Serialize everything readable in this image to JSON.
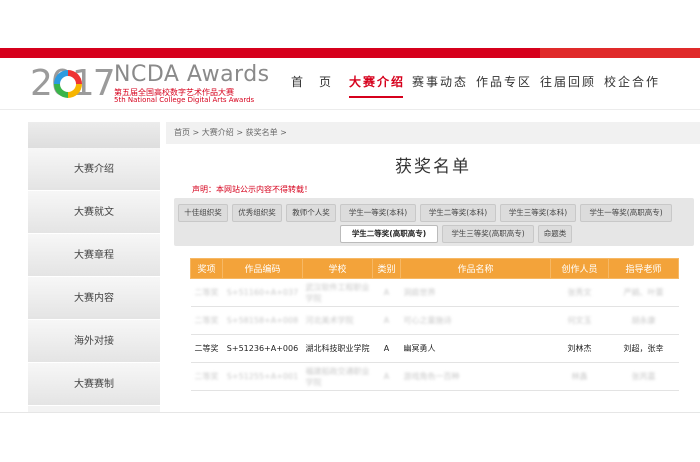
{
  "header": {
    "logo_year": "2017",
    "logo_title": "NCDA Awards",
    "logo_sub_cn": "第五届全国高校数字艺术作品大赛",
    "logo_sub_en": "5th National College Digital Arts Awards",
    "nav": [
      "首　页",
      "大赛介绍",
      "赛事动态",
      "作品专区",
      "往届回顾",
      "校企合作"
    ]
  },
  "sidebar": {
    "items": [
      "大赛介绍",
      "大赛就文",
      "大赛章程",
      "大赛内容",
      "海外对接",
      "大赛赛制"
    ]
  },
  "content": {
    "breadcrumb": "首页 > 大赛介绍 > 获奖名单 >",
    "title": "获奖名单",
    "notice": "声明：本网站公示内容不得转载！",
    "tabs": [
      "十佳组织奖",
      "优秀组织奖",
      "教师个人奖",
      "学生一等奖(本科)",
      "学生二等奖(本科)",
      "学生三等奖(本科)",
      "学生一等奖(高职高专)",
      "学生二等奖(高职高专)",
      "学生三等奖(高职高专)",
      "命题类"
    ],
    "table": {
      "headers": [
        "奖项",
        "作品编码",
        "学校",
        "类别",
        "作品名称",
        "创作人员",
        "指导老师"
      ],
      "rows": [
        [
          "二等奖",
          "S+51160+A+037",
          "武汉软件工程职业学院",
          "A",
          "洞庭世界",
          "张秀文",
          "严娟、叶蕾"
        ],
        [
          "二等奖",
          "S+58158+A+008",
          "河北美术学院",
          "A",
          "可心之童施诗",
          "何文玉",
          "胡永康"
        ],
        [
          "二等奖",
          "S+51236+A+006",
          "湖北科技职业学院",
          "A",
          "幽冥勇人",
          "刘林杰",
          "刘超，张幸"
        ],
        [
          "二等奖",
          "S+51255+A+001",
          "福建船政交通职业学院",
          "A",
          "游戏角色一百种",
          "林鑫",
          "张芮嘉"
        ]
      ]
    }
  }
}
